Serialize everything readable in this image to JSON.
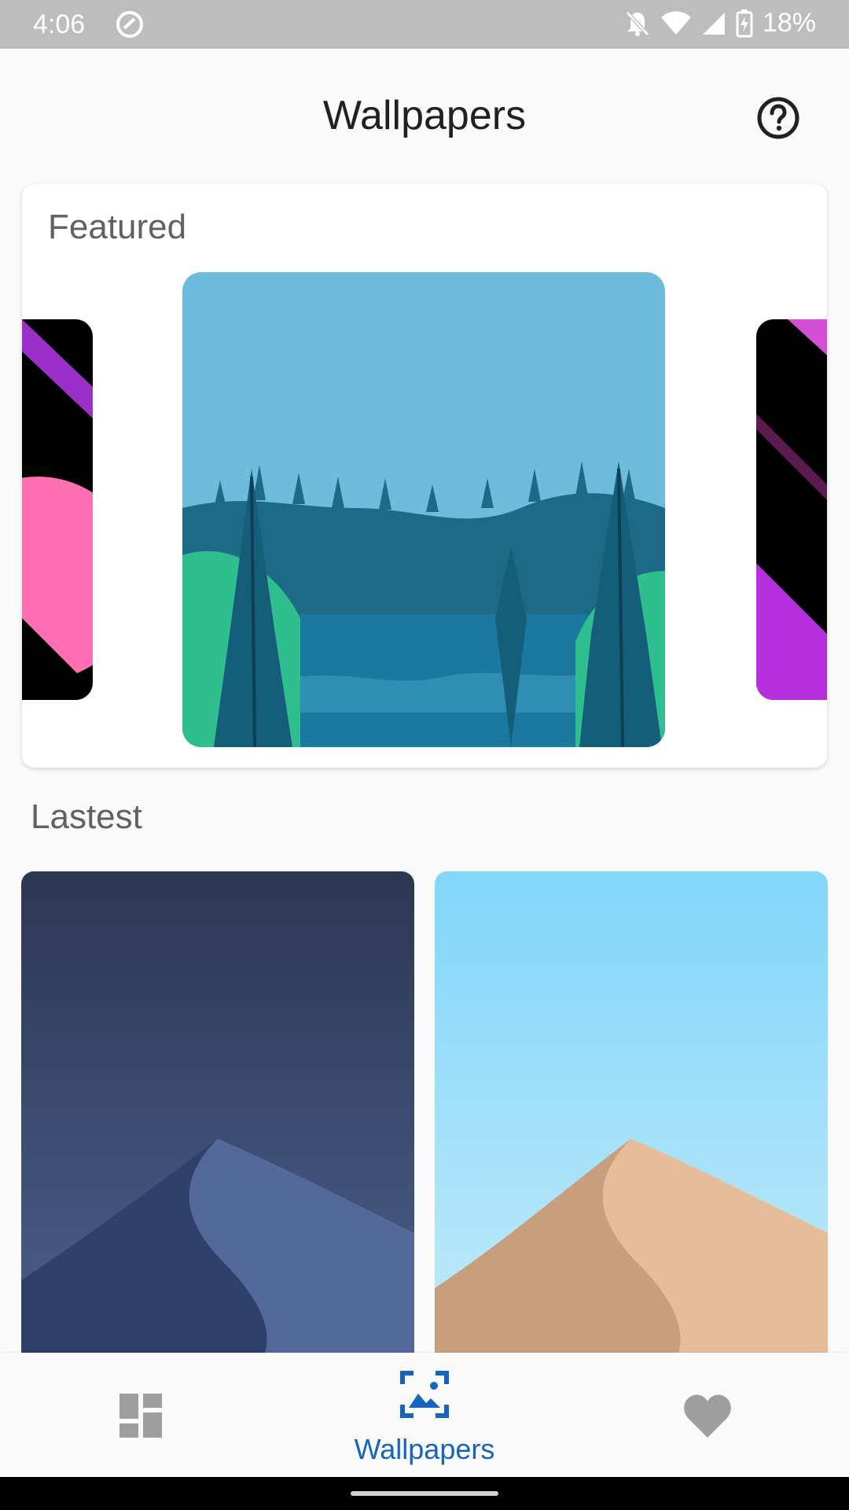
{
  "status_bar": {
    "time": "4:06",
    "battery": "18%",
    "icons": [
      "at-sign-icon",
      "notifications-off-icon",
      "wifi-icon",
      "signal-icon",
      "battery-charging-icon"
    ]
  },
  "header": {
    "title": "Wallpapers",
    "help_icon": "help-circle-icon"
  },
  "featured": {
    "title": "Featured",
    "items": [
      {
        "name": "black-pink-purple-wallpaper"
      },
      {
        "name": "blue-forest-lake-wallpaper"
      },
      {
        "name": "black-magenta-stripes-wallpaper"
      }
    ]
  },
  "latest": {
    "title": "Lastest",
    "items": [
      {
        "name": "navy-dune-wallpaper"
      },
      {
        "name": "sand-dune-wallpaper"
      }
    ]
  },
  "bottom_nav": {
    "items": [
      {
        "icon": "dashboard-icon",
        "label": ""
      },
      {
        "icon": "wallpaper-icon",
        "label": "Wallpapers",
        "active": true
      },
      {
        "icon": "heart-icon",
        "label": ""
      }
    ]
  },
  "colors": {
    "accent": "#1565c0",
    "status_bar": "#bdbdbd",
    "inactive_icon": "#9e9e9e"
  }
}
